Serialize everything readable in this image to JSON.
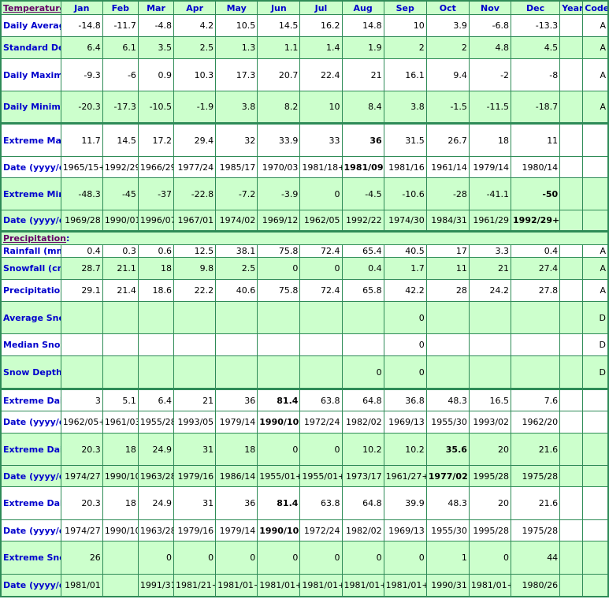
{
  "header": {
    "section_temperature": "Temperature",
    "colon": ":",
    "months": [
      "Jan",
      "Feb",
      "Mar",
      "Apr",
      "May",
      "Jun",
      "Jul",
      "Aug",
      "Sep",
      "Oct",
      "Nov",
      "Dec"
    ],
    "year": "Year",
    "code": "Code"
  },
  "temperature_rows": [
    {
      "label": "Daily Average (°C)",
      "values": [
        "-14.8",
        "-11.7",
        "-4.8",
        "4.2",
        "10.5",
        "14.5",
        "16.2",
        "14.8",
        "10",
        "3.9",
        "-6.8",
        "-13.3"
      ],
      "year": "",
      "code": "A",
      "bold": []
    },
    {
      "label": "Standard Deviation",
      "values": [
        "6.4",
        "6.1",
        "3.5",
        "2.5",
        "1.3",
        "1.1",
        "1.4",
        "1.9",
        "2",
        "2",
        "4.8",
        "4.5"
      ],
      "year": "",
      "code": "A",
      "bold": []
    },
    {
      "label": "Daily Maximum (°C)",
      "values": [
        "-9.3",
        "-6",
        "0.9",
        "10.3",
        "17.3",
        "20.7",
        "22.4",
        "21",
        "16.1",
        "9.4",
        "-2",
        "-8"
      ],
      "year": "",
      "code": "A",
      "bold": []
    },
    {
      "label": "Daily Minimum (°C)",
      "values": [
        "-20.3",
        "-17.3",
        "-10.5",
        "-1.9",
        "3.8",
        "8.2",
        "10",
        "8.4",
        "3.8",
        "-1.5",
        "-11.5",
        "-18.7"
      ],
      "year": "",
      "code": "A",
      "bold": []
    },
    {
      "label": "Extreme Maximum (°C)",
      "values": [
        "11.7",
        "14.5",
        "17.2",
        "29.4",
        "32",
        "33.9",
        "33",
        "36",
        "31.5",
        "26.7",
        "18",
        "11"
      ],
      "year": "",
      "code": "",
      "bold": [
        7
      ]
    },
    {
      "label": "Date (yyyy/dd)",
      "values": [
        "1965/15+",
        "1992/29",
        "1966/29",
        "1977/24",
        "1985/17",
        "1970/03",
        "1981/18+",
        "1981/09",
        "1981/16",
        "1961/14",
        "1979/14",
        "1980/14"
      ],
      "year": "",
      "code": "",
      "bold": [
        7
      ]
    },
    {
      "label": "Extreme Minimum (°C)",
      "values": [
        "-48.3",
        "-45",
        "-37",
        "-22.8",
        "-7.2",
        "-3.9",
        "0",
        "-4.5",
        "-10.6",
        "-28",
        "-41.1",
        "-50"
      ],
      "year": "",
      "code": "",
      "bold": [
        11
      ]
    },
    {
      "label": "Date (yyyy/dd)",
      "values": [
        "1969/28",
        "1990/01",
        "1996/07",
        "1967/01",
        "1974/02",
        "1969/12",
        "1962/05",
        "1992/22",
        "1974/30",
        "1984/31",
        "1961/29",
        "1992/29+"
      ],
      "year": "",
      "code": "",
      "bold": [
        11
      ]
    }
  ],
  "section_precipitation": "Precipitation",
  "precipitation_rows": [
    {
      "label": "Rainfall (mm)",
      "values": [
        "0.4",
        "0.3",
        "0.6",
        "12.5",
        "38.1",
        "75.8",
        "72.4",
        "65.4",
        "40.5",
        "17",
        "3.3",
        "0.4"
      ],
      "year": "",
      "code": "A",
      "bold": []
    },
    {
      "label": "Snowfall (cm)",
      "values": [
        "28.7",
        "21.1",
        "18",
        "9.8",
        "2.5",
        "0",
        "0",
        "0.4",
        "1.7",
        "11",
        "21",
        "27.4"
      ],
      "year": "",
      "code": "A",
      "bold": []
    },
    {
      "label": "Precipitation (mm)",
      "values": [
        "29.1",
        "21.4",
        "18.6",
        "22.2",
        "40.6",
        "75.8",
        "72.4",
        "65.8",
        "42.2",
        "28",
        "24.2",
        "27.8"
      ],
      "year": "",
      "code": "A",
      "bold": []
    },
    {
      "label": "Average Snow Depth (cm)",
      "values": [
        "",
        "",
        "",
        "",
        "",
        "",
        "",
        "",
        "0",
        "",
        "",
        ""
      ],
      "year": "",
      "code": "D",
      "bold": []
    },
    {
      "label": "Median Snow Depth (cm)",
      "values": [
        "",
        "",
        "",
        "",
        "",
        "",
        "",
        "",
        "0",
        "",
        "",
        ""
      ],
      "year": "",
      "code": "D",
      "bold": []
    },
    {
      "label": "Snow Depth at Month-end (cm)",
      "values": [
        "",
        "",
        "",
        "",
        "",
        "",
        "",
        "0",
        "0",
        "",
        "",
        ""
      ],
      "year": "",
      "code": "D",
      "bold": []
    },
    {
      "label": "Extreme Daily Rainfall (mm)",
      "values": [
        "3",
        "5.1",
        "6.4",
        "21",
        "36",
        "81.4",
        "63.8",
        "64.8",
        "36.8",
        "48.3",
        "16.5",
        "7.6"
      ],
      "year": "",
      "code": "",
      "bold": [
        5
      ]
    },
    {
      "label": "Date (yyyy/dd)",
      "values": [
        "1962/05+",
        "1961/03",
        "1955/28",
        "1993/05",
        "1979/14",
        "1990/10",
        "1972/24",
        "1982/02",
        "1969/13",
        "1955/30",
        "1993/02",
        "1962/20"
      ],
      "year": "",
      "code": "",
      "bold": [
        5
      ]
    },
    {
      "label": "Extreme Daily Snowfall (cm)",
      "values": [
        "20.3",
        "18",
        "24.9",
        "31",
        "18",
        "0",
        "0",
        "10.2",
        "10.2",
        "35.6",
        "20",
        "21.6"
      ],
      "year": "",
      "code": "",
      "bold": [
        9
      ]
    },
    {
      "label": "Date (yyyy/dd)",
      "values": [
        "1974/27",
        "1990/10",
        "1963/28",
        "1979/16",
        "1986/14",
        "1955/01+",
        "1955/01+",
        "1973/17",
        "1961/27+",
        "1977/02",
        "1995/28",
        "1975/28"
      ],
      "year": "",
      "code": "",
      "bold": [
        9
      ]
    },
    {
      "label": "Extreme Daily Precipitation (mm)",
      "values": [
        "20.3",
        "18",
        "24.9",
        "31",
        "36",
        "81.4",
        "63.8",
        "64.8",
        "39.9",
        "48.3",
        "20",
        "21.6"
      ],
      "year": "",
      "code": "",
      "bold": [
        5
      ]
    },
    {
      "label": "Date (yyyy/dd)",
      "values": [
        "1974/27",
        "1990/10",
        "1963/28",
        "1979/16",
        "1979/14",
        "1990/10",
        "1972/24",
        "1982/02",
        "1969/13",
        "1955/30",
        "1995/28",
        "1975/28"
      ],
      "year": "",
      "code": "",
      "bold": [
        5
      ]
    },
    {
      "label": "Extreme Snow Depth (cm)",
      "values": [
        "26",
        "",
        "0",
        "0",
        "0",
        "0",
        "0",
        "0",
        "0",
        "1",
        "0",
        "44"
      ],
      "year": "",
      "code": "",
      "bold": []
    },
    {
      "label": "Date (yyyy/dd)",
      "values": [
        "1981/01",
        "",
        "1991/31",
        "1981/21+",
        "1981/01+",
        "1981/01+",
        "1981/01+",
        "1981/01+",
        "1981/01+",
        "1990/31",
        "1981/01+",
        "1980/26"
      ],
      "year": "",
      "code": "",
      "bold": []
    }
  ],
  "colors": {
    "border": "#2e8b57",
    "row_green": "#ccffcc",
    "row_white": "#ffffff",
    "label_blue": "#0000cc",
    "section_link": "#660066"
  }
}
